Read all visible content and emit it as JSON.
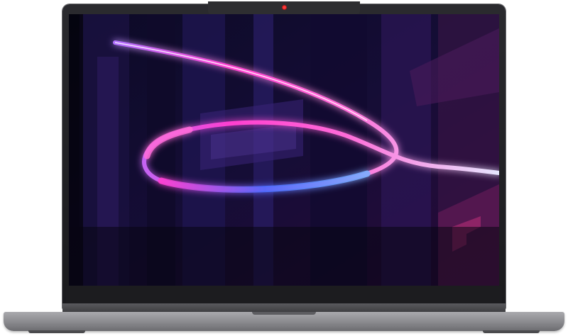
{
  "product": {
    "type": "laptop",
    "color_body": "#8f8f93",
    "color_bezel": "#1c1c1f",
    "webcam_indicator_color": "#e02020"
  },
  "wallpaper": {
    "theme": "neon light ribbon over dark architectural shapes",
    "colors": [
      "#ff3fd0",
      "#7a5cff",
      "#3a6bff",
      "#2a0a44",
      "#0a0718"
    ]
  }
}
